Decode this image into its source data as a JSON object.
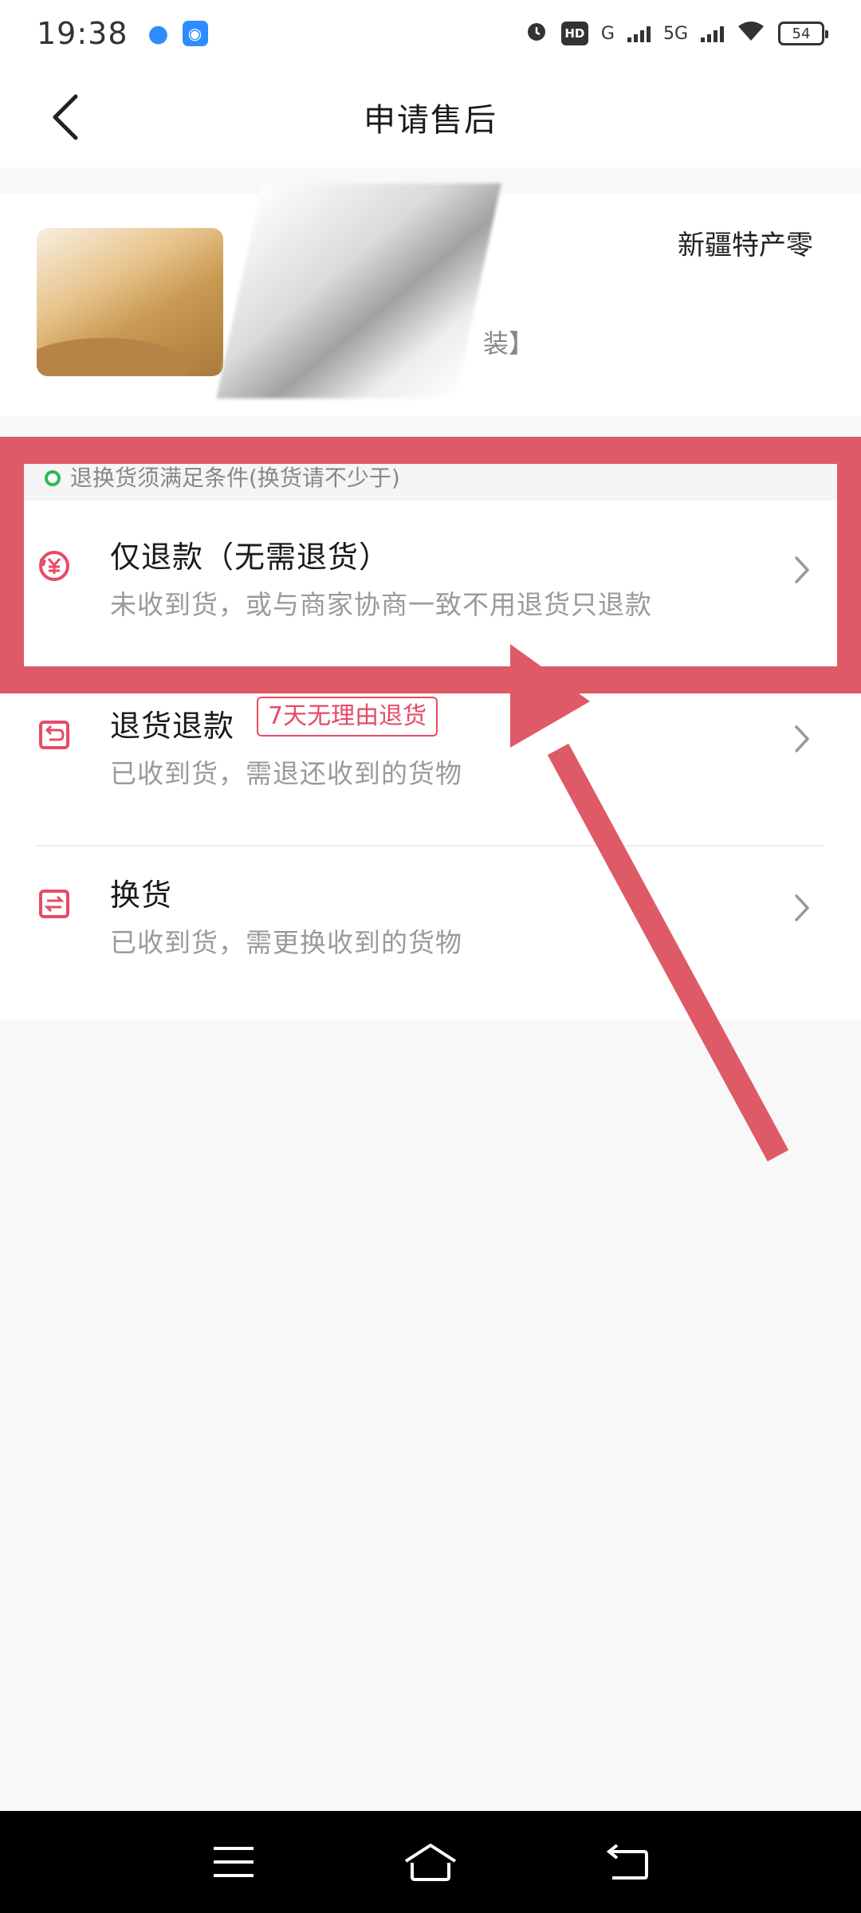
{
  "status_bar": {
    "time": "19:38",
    "network_hd": "HD",
    "network_g": "G",
    "network_5g": "5G",
    "battery": "54"
  },
  "header": {
    "title": "申请售后",
    "back_icon": "chevron-left-icon"
  },
  "product": {
    "title": "新疆特产零",
    "spec": "装】",
    "image_desc": "product-thumbnail"
  },
  "notice": {
    "text": "退换货须满足条件(换货请不少于)"
  },
  "options": [
    {
      "icon": "yuan-refund-icon",
      "title": "仅退款（无需退货）",
      "desc": "未收到货，或与商家协商一致不用退货只退款"
    },
    {
      "icon": "return-box-icon",
      "title": "退货退款",
      "tag": "7天无理由退货",
      "desc": "已收到货，需退还收到的货物"
    },
    {
      "icon": "exchange-icon",
      "title": "换货",
      "desc": "已收到货，需更换收到的货物"
    }
  ],
  "colors": {
    "accent": "#e64b66",
    "annotation": "#de5a67",
    "background": "#f8f8f8"
  },
  "system_nav": [
    "menu-icon",
    "home-icon",
    "back-icon"
  ]
}
